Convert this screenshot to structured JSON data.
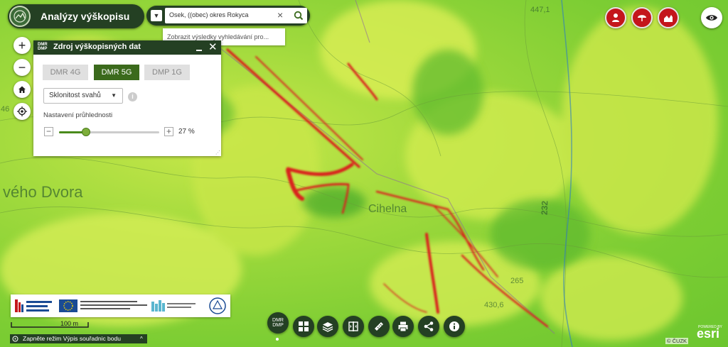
{
  "header": {
    "title": "Analýzy výškopisu"
  },
  "search": {
    "value": "Osek, ((obec) okres Rokyca",
    "suggestion": "Zobrazit výsledky vyhledávání pro..."
  },
  "map_controls": {
    "zoom_in": "+",
    "zoom_out": "−"
  },
  "panel": {
    "mini_label_1": "DMR",
    "mini_label_2": "DMP",
    "title": "Zdroj výškopisných dat",
    "tabs": [
      {
        "label": "DMR 4G",
        "active": false
      },
      {
        "label": "DMR 5G",
        "active": true
      },
      {
        "label": "DMP 1G",
        "active": false
      }
    ],
    "layer_select": "Sklonitost svahů",
    "info": "i",
    "opacity_label": "Nastavení průhlednosti",
    "opacity_value": "27 %",
    "opacity_fraction": 0.27,
    "minus": "−",
    "plus": "+"
  },
  "map_labels": {
    "place_left": "vého Dvora",
    "place_center": "Cihelna",
    "elevation_top": "447,1",
    "elevation_left": "46",
    "road_number": "232",
    "elevation_265": "265",
    "elevation_430": "430,6"
  },
  "scale": {
    "label": "100 m"
  },
  "coord_bar": {
    "label": "Zapněte režim Výpis souřadnic bodu",
    "chevron": "^"
  },
  "toolbar": {
    "dmr_line1": "DMR",
    "dmr_line2": "DMP"
  },
  "attribution": {
    "cuzk": "© ČUZK",
    "powered_by": "POWERED BY",
    "esri": "esri"
  },
  "colors": {
    "header_bg": "#244023",
    "active_tab": "#3b6a1c",
    "tool_red": "#c4161c",
    "map_green": "#7ccd33",
    "map_yellow": "#d7ec4f",
    "slope_red": "#d9201a"
  }
}
